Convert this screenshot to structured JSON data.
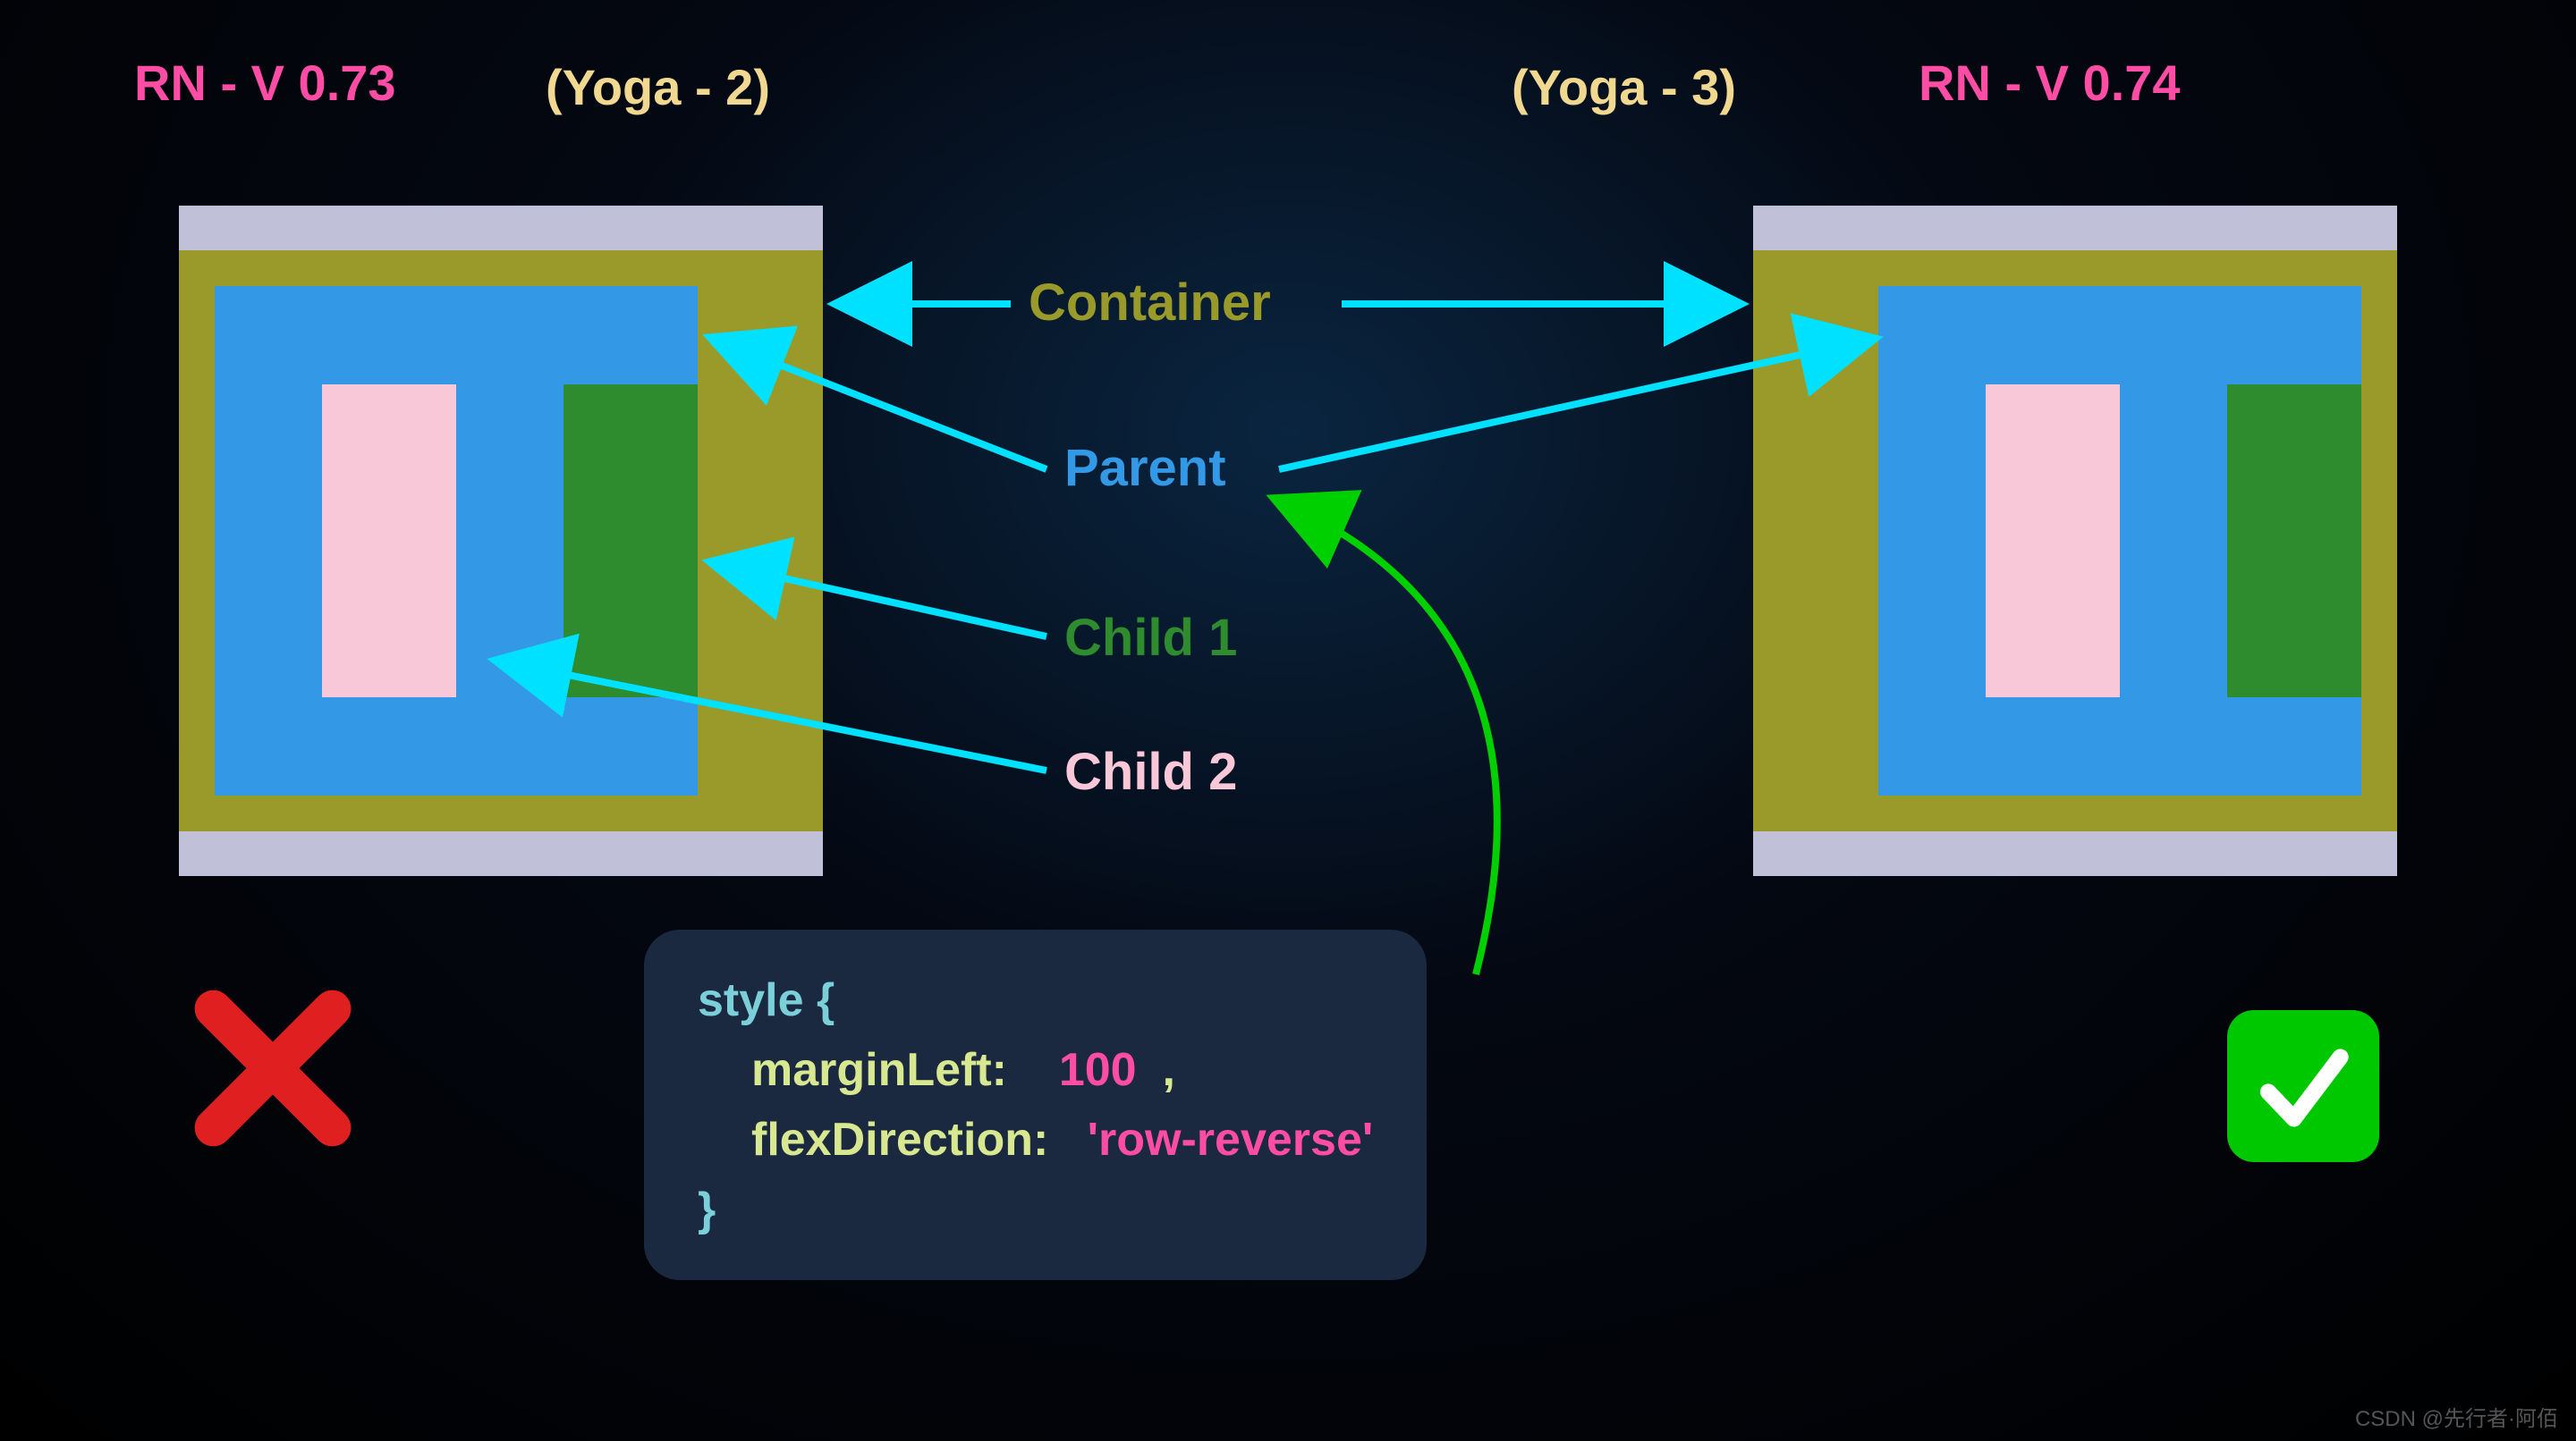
{
  "header": {
    "left_version": "RN - V 0.73",
    "left_yoga": "(Yoga - 2)",
    "right_yoga": "(Yoga - 3)",
    "right_version": "RN - V 0.74"
  },
  "labels": {
    "container": "Container",
    "parent": "Parent",
    "child1": "Child 1",
    "child2": "Child 2"
  },
  "code": {
    "open": "style {",
    "marginLeft_key": "marginLeft:",
    "marginLeft_val": "100",
    "marginLeft_comma": ",",
    "flexDirection_key": "flexDirection:",
    "flexDirection_val": "'row-reverse'",
    "close": "}"
  },
  "icons": {
    "cross": "cross-icon",
    "check": "check-icon"
  },
  "watermark": "CSDN @先行者·阿佰",
  "colors": {
    "pink": "#ff4da6",
    "yellow": "#f0d890",
    "olive": "#9a9a2a",
    "blue": "#3399e6",
    "green": "#2e8b2e",
    "lightpink": "#f8c8d8",
    "cyan_arrow": "#00e0ff",
    "green_arrow": "#00d000"
  }
}
